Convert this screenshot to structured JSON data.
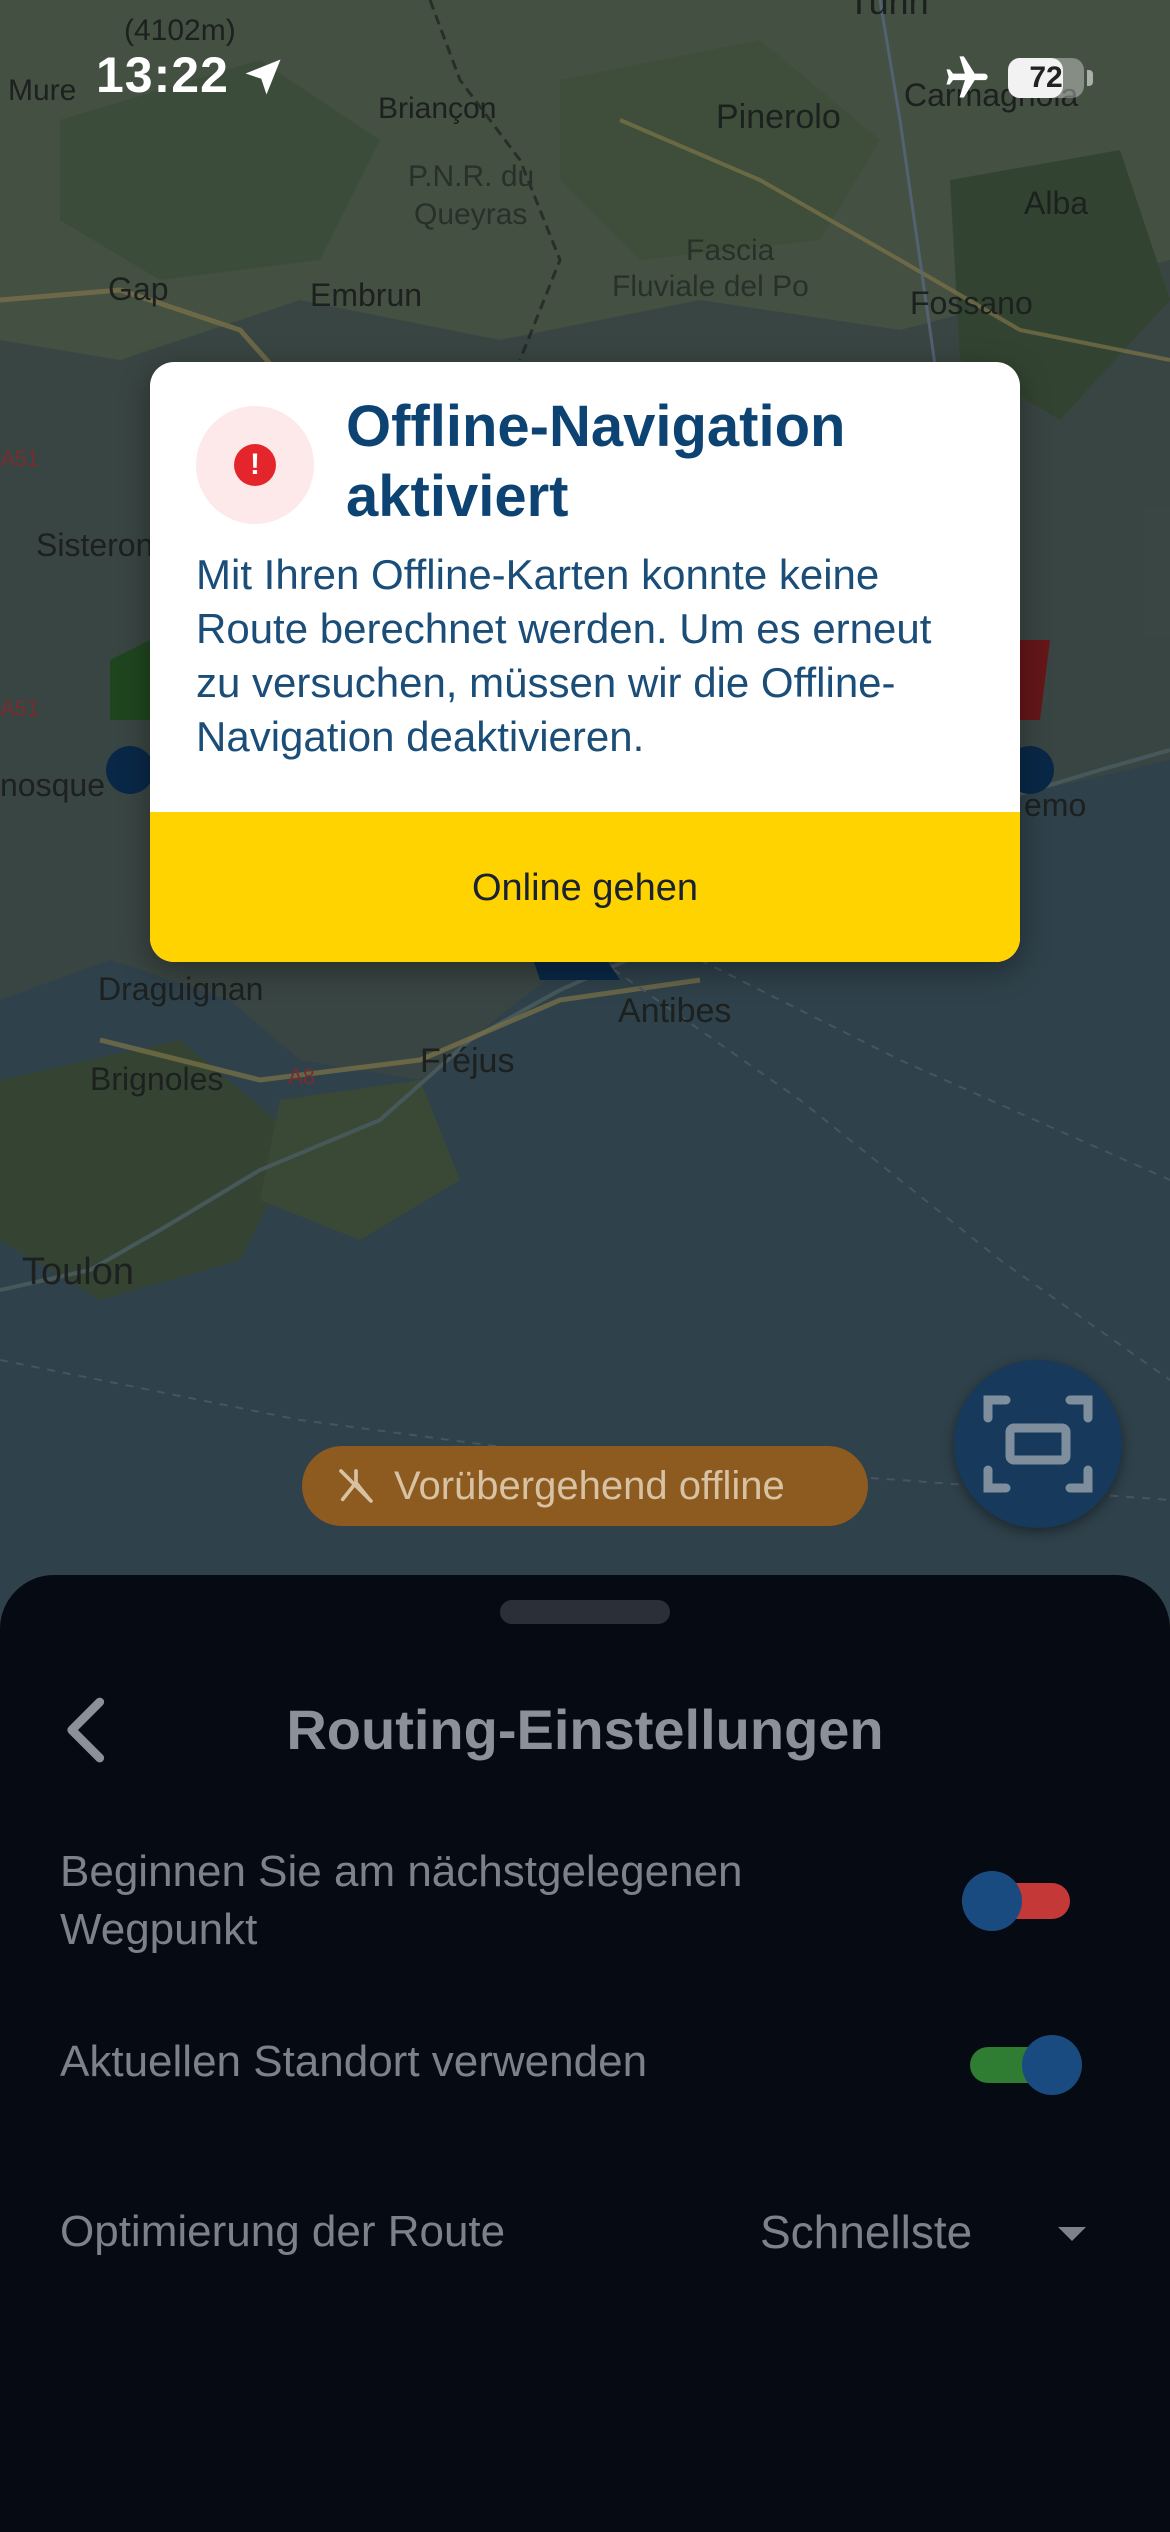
{
  "status_bar": {
    "time": "13:22",
    "battery": "72",
    "battery_level": 0.72
  },
  "map": {
    "places": [
      "Mure",
      "(4102m)",
      "Briançon",
      "Turin",
      "Pinerolo",
      "Carmagnola",
      "Alba",
      "P.N.R. du",
      "Queyras",
      "Fascia",
      "Fluviale del Po",
      "Fossano",
      "Gap",
      "Embrun",
      "A51",
      "Sisteron",
      "A51",
      "nosque",
      "emo",
      "Draguignan",
      "Antibes",
      "Brignoles",
      "A8",
      "Fréjus",
      "Toulon"
    ]
  },
  "dialog": {
    "title": "Offline-Navigation aktiviert",
    "body": "Mit Ihren Offline-Karten konnte keine Route berechnet werden. Um es erneut zu versuchen, müssen wir die Offline-Navigation deaktivieren.",
    "button": "Online gehen"
  },
  "offline_pill": {
    "label": "Vorübergehend offline"
  },
  "sheet": {
    "title": "Routing-Einstellungen",
    "settings": [
      {
        "label": "Beginnen Sie am nächstgelegenen Wegpunkt",
        "on": false
      },
      {
        "label": "Aktuellen Standort verwenden",
        "on": true
      }
    ],
    "optimization": {
      "label": "Optimierung der Route",
      "value": "Schnellste"
    }
  },
  "colors": {
    "accent_yellow": "#ffd300",
    "title_blue": "#0d4373",
    "toggle_off": "#c43838",
    "toggle_on": "#2e7d32",
    "knob": "#1a4b80"
  }
}
